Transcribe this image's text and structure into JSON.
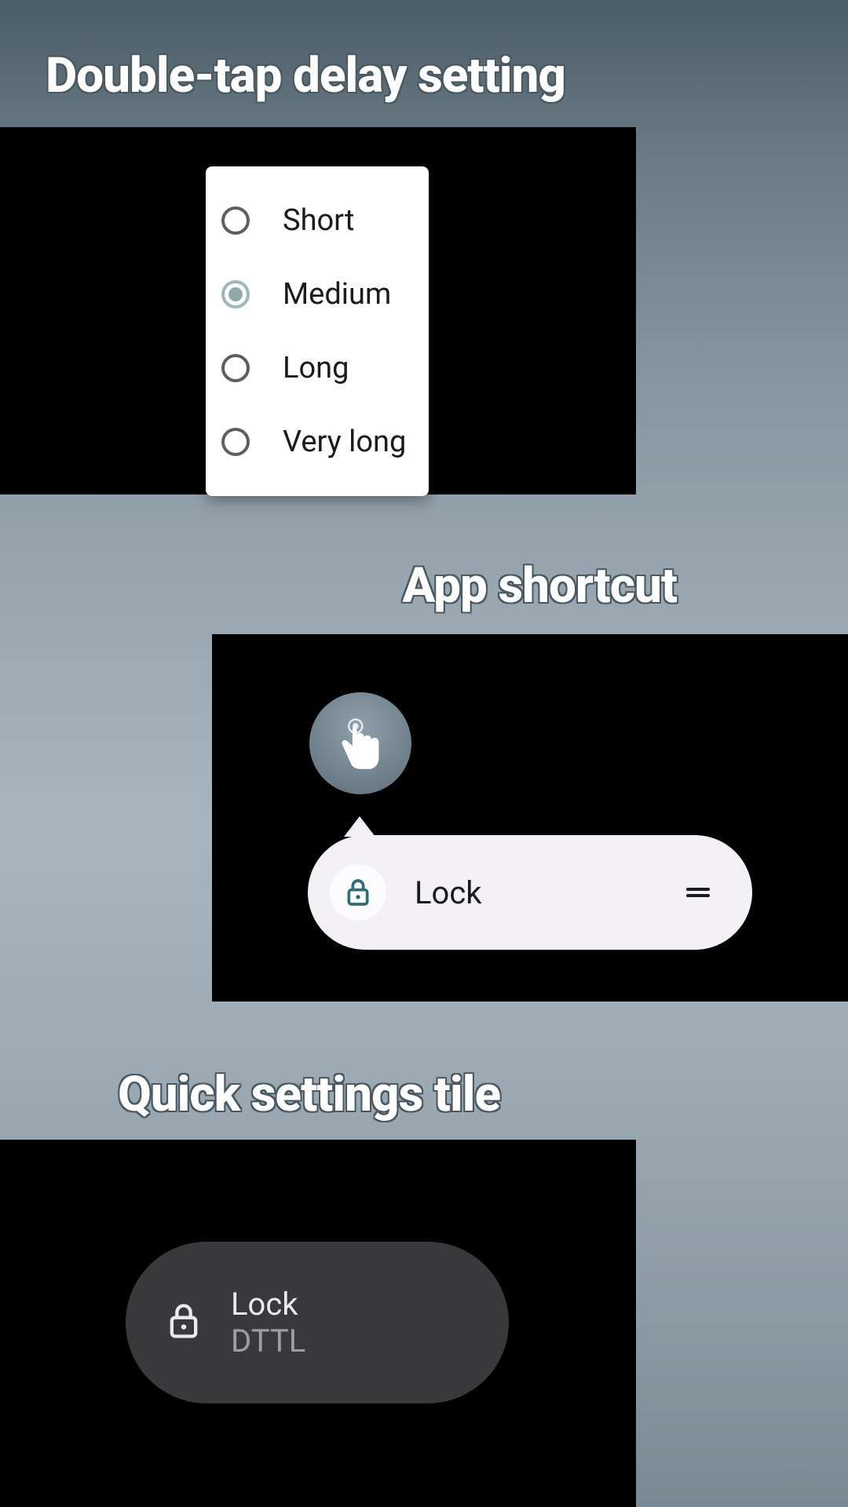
{
  "section1": {
    "title": "Double-tap delay setting",
    "options": [
      "Short",
      "Medium",
      "Long",
      "Very long"
    ],
    "selected_index": 1
  },
  "section2": {
    "title": "App shortcut",
    "shortcut_label": "Lock"
  },
  "section3": {
    "title": "Quick settings tile",
    "tile_title": "Lock",
    "tile_subtitle": "DTTL"
  }
}
